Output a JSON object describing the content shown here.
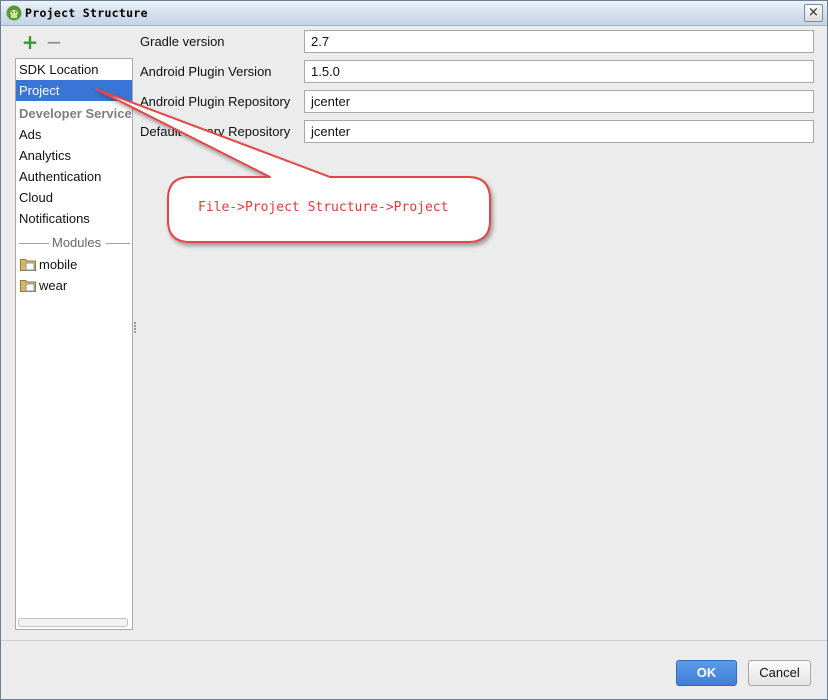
{
  "window": {
    "title": "Project Structure",
    "close_glyph": "×",
    "icon": "android-studio-icon"
  },
  "toolbar": {
    "add_glyph": "+",
    "remove_glyph": "−"
  },
  "sidebar": {
    "items": [
      {
        "label": "SDK Location",
        "selected": false
      },
      {
        "label": "Project",
        "selected": true
      }
    ],
    "developer_services_header": "Developer Services",
    "services": [
      "Ads",
      "Analytics",
      "Authentication",
      "Cloud",
      "Notifications"
    ],
    "modules_header": "Modules",
    "modules": [
      "mobile",
      "wear"
    ]
  },
  "form": {
    "fields": [
      {
        "label": "Gradle version",
        "value": "2.7"
      },
      {
        "label": "Android Plugin Version",
        "value": "1.5.0"
      },
      {
        "label": "Android Plugin Repository",
        "value": "jcenter"
      },
      {
        "label": "Default Library Repository",
        "value": "jcenter"
      }
    ]
  },
  "annotation": {
    "text": "File->Project Structure->Project",
    "color": "#e23a3a"
  },
  "buttons": {
    "ok": "OK",
    "cancel": "Cancel"
  },
  "colors": {
    "selection": "#3875d7",
    "ok_button": "#4a8be0",
    "add_icon": "#2f9a2f"
  }
}
